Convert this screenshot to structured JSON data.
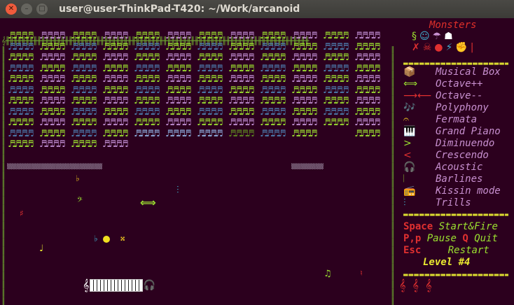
{
  "window": {
    "title": "user@user-ThinkPad-T420: ~/Work/arcanoid",
    "buttons": {
      "close": "✕",
      "minimize": "–",
      "maximize": "□"
    }
  },
  "colors": {
    "background": "#2c001e",
    "frame": "#70b030",
    "brick_green": "#9be030",
    "brick_pink": "#c08ed2",
    "brick_blue": "#4d7fb0",
    "label_purple": "#c890d0",
    "key_red": "#e03030",
    "level_yellow": "#e8e830"
  },
  "sidebar": {
    "monsters_title": "Monsters",
    "legend": [
      {
        "icon": "📦",
        "label": "Musical Box",
        "color": "#e8c020"
      },
      {
        "icon": "⟺",
        "label": "Octave++",
        "color": "#9be030"
      },
      {
        "icon": "⟶⟵",
        "label": "Octave--",
        "color": "#e03030"
      },
      {
        "icon": "🎶",
        "label": "Polyphony",
        "color": "#40b0d0"
      },
      {
        "icon": "𝄐",
        "label": "Fermata",
        "color": "#e8c020"
      },
      {
        "icon": "🎹",
        "label": "Grand Piano",
        "color": "#ffffff"
      },
      {
        "icon": ">",
        "label": "Diminuendo",
        "color": "#9be030"
      },
      {
        "icon": "<",
        "label": "Crescendo",
        "color": "#e03030"
      },
      {
        "icon": "🎧",
        "label": "Acoustic",
        "color": "#e8c020"
      },
      {
        "icon": "𝄀",
        "label": "Barlines",
        "color": "#9be030"
      },
      {
        "icon": "📻",
        "label": "Kissin mode",
        "color": "#ffffff"
      },
      {
        "icon": "⫶",
        "label": "Trills",
        "color": "#40b0d0"
      }
    ],
    "controls": [
      {
        "key": "Space",
        "action": "Start&Fire"
      },
      {
        "key": "P,p",
        "action": "Pause",
        "key2": "Q",
        "action2": "Quit"
      },
      {
        "key": "Esc",
        "action": "Restart"
      }
    ],
    "level": "Level #4",
    "lives": "𝄞 𝄞 𝄞"
  },
  "board": {
    "rows": [
      [
        "green",
        "pink",
        "green",
        "pink",
        "green",
        "pink",
        "green",
        "pink",
        "green",
        "pink",
        "green",
        "pink"
      ],
      [
        "blue",
        "green",
        "blue",
        "green",
        "blue",
        "green",
        "blue",
        "green",
        "blue",
        "green",
        "blue",
        "green"
      ],
      [
        "green",
        "pink",
        "green",
        "pink",
        "green",
        "pink",
        "green",
        "pink",
        "green",
        "pink",
        "green",
        "pink"
      ],
      [
        "blue",
        "green",
        "blue",
        "green",
        "blue",
        "green",
        "blue",
        "green",
        "blue",
        "green",
        "blue",
        "green"
      ],
      [
        "green",
        "pink",
        "green",
        "pink",
        "green",
        "pink",
        "green",
        "pink",
        "green",
        "pink",
        "green",
        "pink"
      ],
      [
        "blue",
        "green",
        "blue",
        "green",
        "blue",
        "green",
        "blue",
        "green",
        "blue",
        "green",
        "blue",
        "green"
      ],
      [
        "green",
        "pink",
        "green",
        "pink",
        "green",
        "pink",
        "green",
        "pink",
        "green",
        "pink",
        "green",
        "pink"
      ],
      [
        "blue",
        "green",
        "blue",
        "green",
        "blue",
        "green",
        "blue",
        "green",
        "blue",
        "green",
        "blue",
        "green"
      ],
      [
        "green",
        "pink",
        "green",
        "pink",
        "green",
        "pink",
        "green",
        "pink",
        "green",
        "pink",
        "green",
        "pink"
      ],
      [
        "blue",
        "green",
        "blue",
        "green",
        "lblue",
        "lblue",
        "lblue",
        "dgreen",
        "blue",
        "green",
        "none",
        "green"
      ],
      [
        "green",
        "pink",
        "green",
        "pink",
        "none",
        "none",
        "none",
        "none",
        "none",
        "none",
        "none",
        "none"
      ]
    ],
    "glyph": "♬♬♬♬"
  }
}
